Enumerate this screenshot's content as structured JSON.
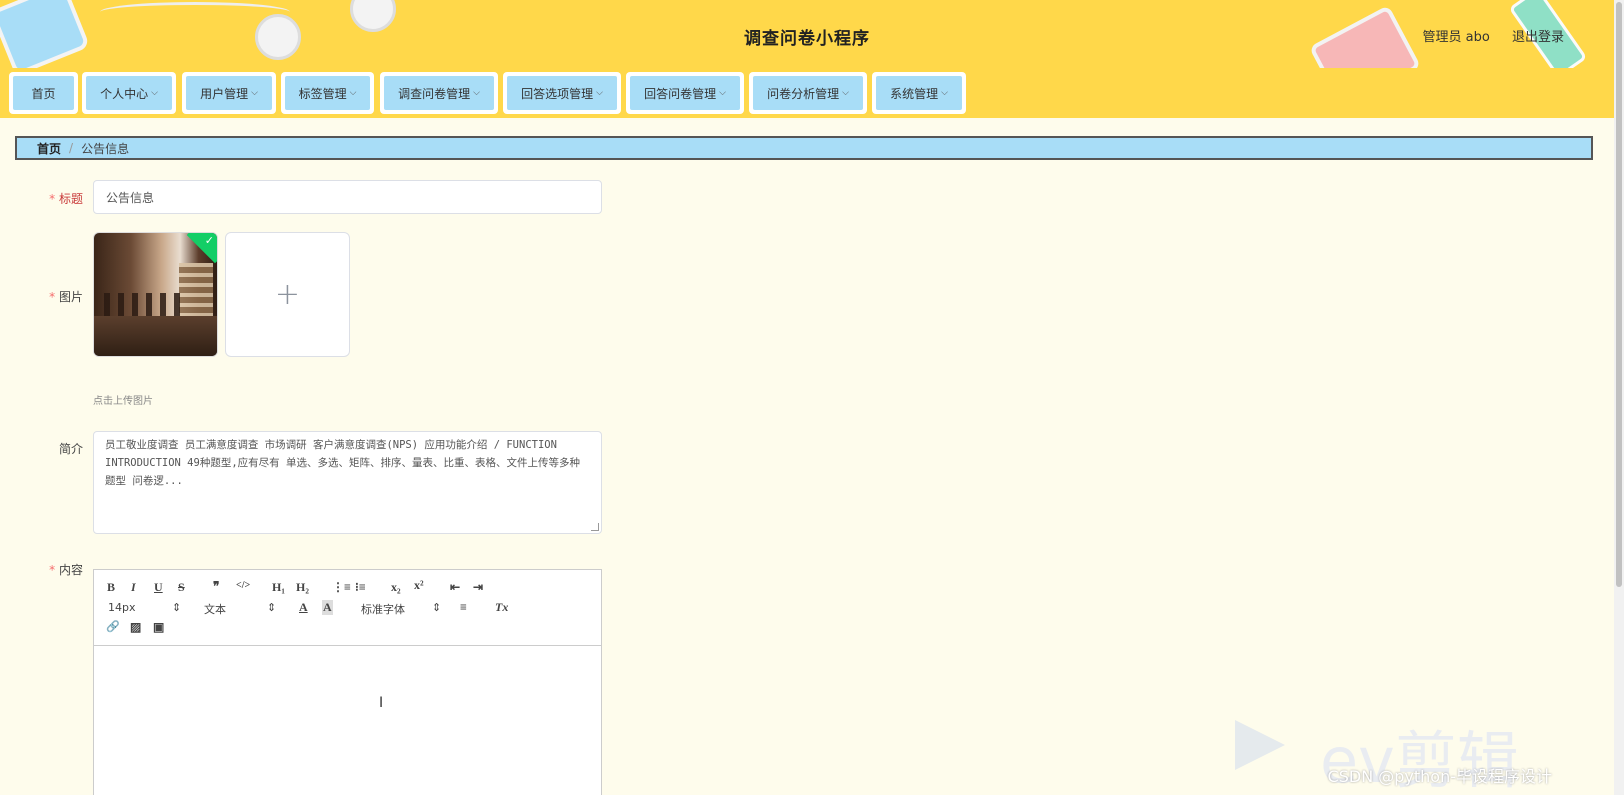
{
  "header": {
    "app_title": "调查问卷小程序",
    "user_label": "管理员 abo",
    "logout_label": "退出登录"
  },
  "nav": {
    "items": [
      {
        "label": "首页",
        "has_dropdown": false
      },
      {
        "label": "个人中心",
        "has_dropdown": true
      },
      {
        "label": "用户管理",
        "has_dropdown": true
      },
      {
        "label": "标签管理",
        "has_dropdown": true
      },
      {
        "label": "调查问卷管理",
        "has_dropdown": true
      },
      {
        "label": "回答选项管理",
        "has_dropdown": true
      },
      {
        "label": "回答问卷管理",
        "has_dropdown": true
      },
      {
        "label": "问卷分析管理",
        "has_dropdown": true
      },
      {
        "label": "系统管理",
        "has_dropdown": true
      }
    ],
    "chevron": "⌵"
  },
  "breadcrumb": {
    "home": "首页",
    "separator": "/",
    "current": "公告信息"
  },
  "form": {
    "title_label": "标题",
    "title_value": "公告信息",
    "image_label": "图片",
    "upload_plus": "+",
    "upload_tip": "点击上传图片",
    "intro_label": "简介",
    "intro_value": "员工敬业度调查 员工满意度调查 市场调研 客户满意度调查(NPS) 应用功能介绍 / FUNCTION INTRODUCTION 49种题型,应有尽有 单选、多选、矩阵、排序、量表、比重、表格、文件上传等多种题型 问卷逻...",
    "content_label": "内容"
  },
  "editor": {
    "font_size": "14px",
    "header_select": "文本",
    "font_family": "标准字体",
    "buttons": {
      "bold": "B",
      "italic": "I",
      "underline": "U",
      "strike": "S",
      "quote": "❞",
      "code": "</>",
      "h1": "H₁",
      "h2": "H₂",
      "ordered_list": "⋮≡",
      "bullet_list": "⁝≡",
      "subscript": "x₂",
      "superscript": "x²",
      "outdent": "⇤",
      "indent": "⇥",
      "color": "A",
      "background": "A",
      "align": "≡",
      "clean": "Tx",
      "link": "🔗",
      "image": "▨",
      "video": "▣",
      "select_arrow": "⇕"
    }
  },
  "watermark": {
    "csdn": "CSDN @python-毕设程序设计",
    "ev": "ev剪辑"
  },
  "icons": {
    "check": "✓",
    "text_cursor": "I"
  },
  "colors": {
    "header_bg": "#ffd84a",
    "nav_item_bg": "#a8ddf7",
    "page_bg": "#fefcec",
    "required": "#f56c6c",
    "success": "#13ce66"
  }
}
